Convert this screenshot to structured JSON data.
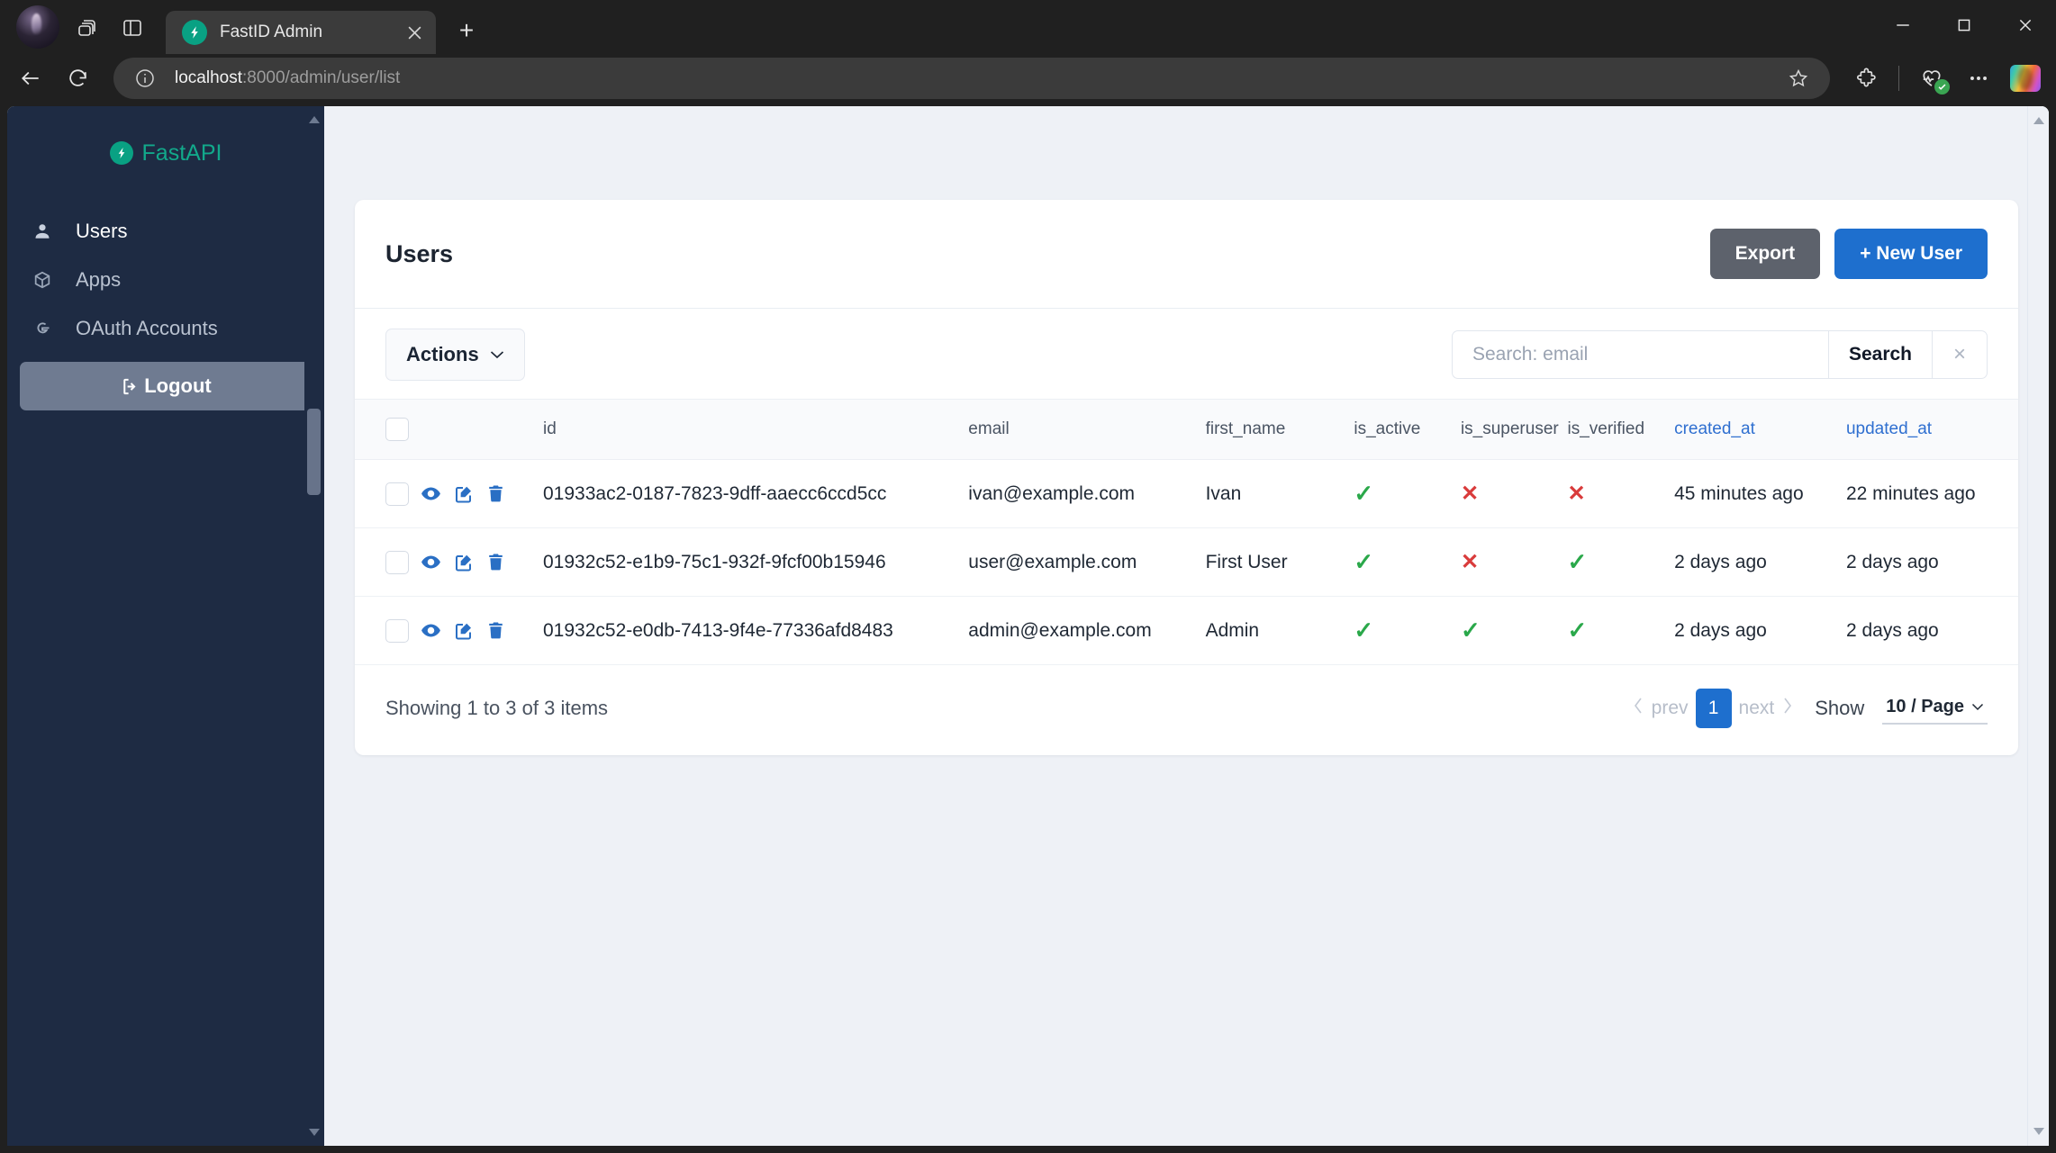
{
  "browser": {
    "tab": {
      "title": "FastID Admin",
      "favicon": "bolt-circle-icon"
    },
    "new_tab_label": "+",
    "url_host": "localhost",
    "url_path": ":8000/admin/user/list",
    "window_controls": {
      "minimize": "minimize-icon",
      "maximize": "maximize-icon",
      "close": "close-icon"
    },
    "toolbar_icons": [
      "profile-avatar",
      "tab-groups-icon",
      "split-screen-icon",
      "back-icon",
      "refresh-icon",
      "info-icon",
      "favorite-star-icon",
      "extensions-icon",
      "browser-essentials-icon",
      "settings-more-icon",
      "copilot-icon"
    ]
  },
  "sidebar": {
    "brand": "FastAPI",
    "items": [
      {
        "label": "Users",
        "icon": "user-icon",
        "active": true
      },
      {
        "label": "Apps",
        "icon": "box-icon",
        "active": false
      },
      {
        "label": "OAuth Accounts",
        "icon": "google-g-icon",
        "active": false
      }
    ],
    "logout_label": "Logout",
    "logout_icon": "logout-icon"
  },
  "page": {
    "title": "Users",
    "export_label": "Export",
    "new_user_label": "+ New User",
    "actions_label": "Actions",
    "search": {
      "placeholder": "Search: email",
      "value": "",
      "button_label": "Search",
      "clear_label": "×"
    },
    "colors": {
      "primary": "#1e6fce",
      "export": "#5d626c",
      "sidebar": "#1e2b43",
      "brand": "#12a98b",
      "ok": "#2aa84a",
      "no": "#d93b3b",
      "sort_link": "#2f6fd0"
    }
  },
  "table": {
    "columns": [
      {
        "key": "select",
        "label": ""
      },
      {
        "key": "ops",
        "label": ""
      },
      {
        "key": "id",
        "label": "id",
        "sortable": false
      },
      {
        "key": "email",
        "label": "email",
        "sortable": false
      },
      {
        "key": "first_name",
        "label": "first_name",
        "sortable": false
      },
      {
        "key": "is_active",
        "label": "is_active",
        "sortable": false
      },
      {
        "key": "is_superuser",
        "label": "is_superuser",
        "sortable": false
      },
      {
        "key": "is_verified",
        "label": "is_verified",
        "sortable": false
      },
      {
        "key": "created_at",
        "label": "created_at",
        "sortable": true
      },
      {
        "key": "updated_at",
        "label": "updated_at",
        "sortable": true
      }
    ],
    "row_ops": [
      "view-icon",
      "edit-icon",
      "delete-icon"
    ],
    "rows": [
      {
        "id": "01933ac2-0187-7823-9dff-aaecc6ccd5cc",
        "email": "ivan@example.com",
        "first_name": "Ivan",
        "is_active": true,
        "is_superuser": false,
        "is_verified": false,
        "created_at": "45 minutes ago",
        "updated_at": "22 minutes ago"
      },
      {
        "id": "01932c52-e1b9-75c1-932f-9fcf00b15946",
        "email": "user@example.com",
        "first_name": "First User",
        "is_active": true,
        "is_superuser": false,
        "is_verified": true,
        "created_at": "2 days ago",
        "updated_at": "2 days ago"
      },
      {
        "id": "01932c52-e0db-7413-9f4e-77336afd8483",
        "email": "admin@example.com",
        "first_name": "Admin",
        "is_active": true,
        "is_superuser": true,
        "is_verified": true,
        "created_at": "2 days ago",
        "updated_at": "2 days ago"
      }
    ],
    "mark_true": "✓",
    "mark_false": "✕"
  },
  "footer": {
    "showing": "Showing 1 to 3 of 3 items",
    "prev_label": "prev",
    "next_label": "next",
    "current_page": "1",
    "show_label": "Show",
    "per_page": "10 / Page"
  }
}
